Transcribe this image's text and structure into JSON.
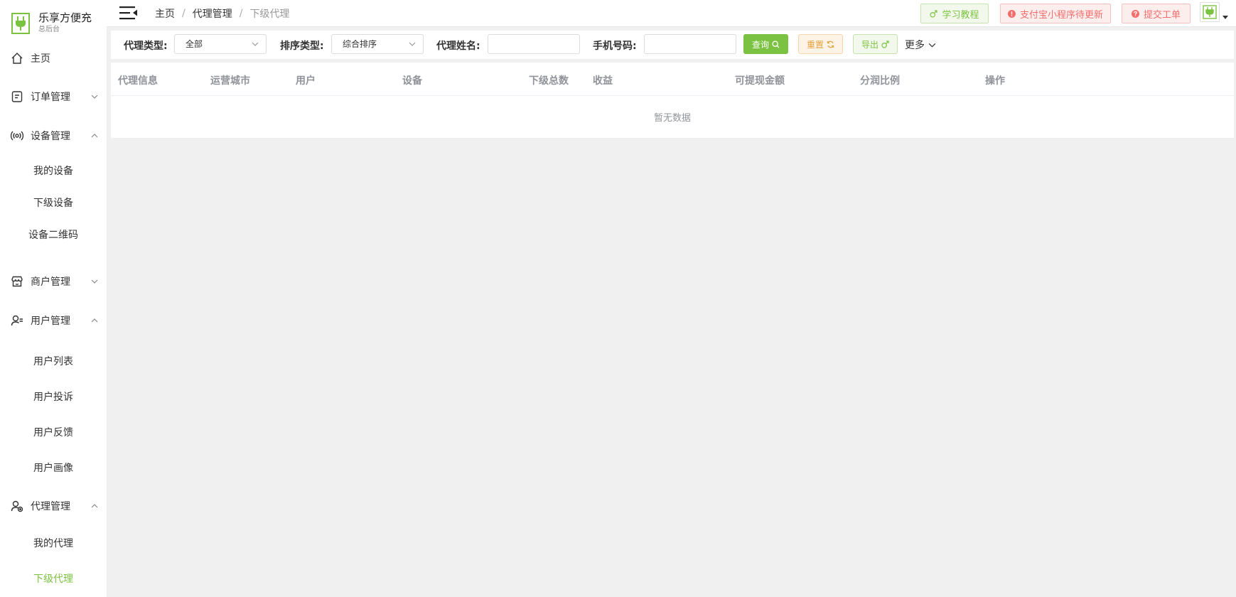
{
  "brand": {
    "title": "乐享方便充",
    "subtitle": "总后台"
  },
  "sidebar": {
    "items": [
      {
        "label": "主页"
      },
      {
        "label": "订单管理"
      },
      {
        "label": "设备管理"
      },
      {
        "label": "商户管理"
      },
      {
        "label": "用户管理"
      },
      {
        "label": "代理管理"
      }
    ],
    "device_sub": [
      "我的设备",
      "下级设备",
      "设备二维码"
    ],
    "user_sub": [
      "用户列表",
      "用户投诉",
      "用户反馈",
      "用户画像"
    ],
    "agent_sub": [
      "我的代理",
      "下级代理"
    ]
  },
  "header": {
    "breadcrumb": [
      "主页",
      "代理管理",
      "下级代理"
    ],
    "separator": "/",
    "buttons": {
      "tutorial": "学习教程",
      "alipay": "支付宝小程序待更新",
      "ticket": "提交工单"
    }
  },
  "filters": {
    "agent_type_label": "代理类型:",
    "agent_type_value": "全部",
    "sort_type_label": "排序类型:",
    "sort_type_value": "综合排序",
    "agent_name_label": "代理姓名:",
    "agent_name_value": "",
    "phone_label": "手机号码:",
    "phone_value": "",
    "query": "查询",
    "reset": "重置",
    "export": "导出",
    "more": "更多"
  },
  "table": {
    "columns": [
      "代理信息",
      "运营城市",
      "用户",
      "设备",
      "下级总数",
      "收益",
      "可提现金额",
      "分润比例",
      "操作"
    ],
    "rows": [],
    "empty_text": "暂无数据"
  },
  "colors": {
    "accent": "#7cc242",
    "danger": "#f56c6c",
    "warning": "#e6a23c"
  }
}
